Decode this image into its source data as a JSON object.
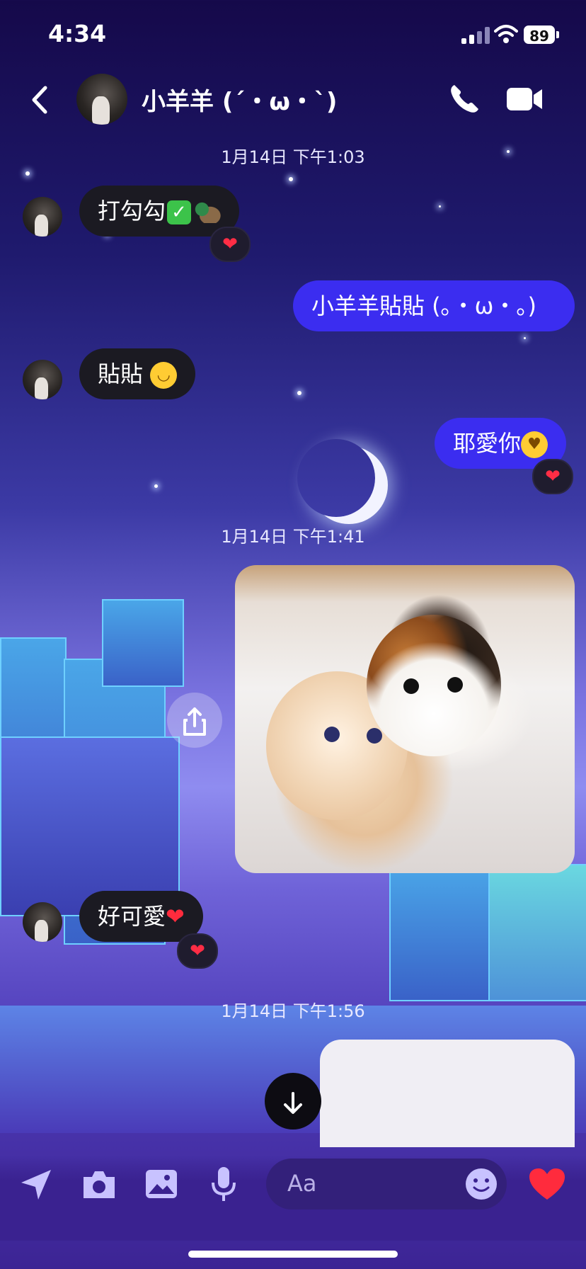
{
  "status_bar": {
    "time": "4:34",
    "battery": "89"
  },
  "header": {
    "contact_name": "小羊羊 (´・ω・`)",
    "back_icon": "chevron-left-icon",
    "call_icon": "phone-icon",
    "video_icon": "video-camera-icon"
  },
  "messages": {
    "ts1": "1月14日 下午1:03",
    "m1": {
      "text": "打勾勾",
      "reaction": "❤"
    },
    "m2": {
      "text": "小羊羊貼貼 (｡・ω・｡)"
    },
    "m3": {
      "text": "貼貼"
    },
    "m4": {
      "text": "耶愛你",
      "reaction": "❤"
    },
    "ts2": "1月14日 下午1:41",
    "m5": {
      "type": "photo"
    },
    "m6": {
      "text": "好可愛",
      "reaction": "❤"
    },
    "ts3": "1月14日 下午1:56"
  },
  "composer": {
    "placeholder": "Aa",
    "icons": [
      "location-arrow-icon",
      "camera-icon",
      "image-icon",
      "microphone-icon",
      "emoji-icon",
      "heart-icon"
    ]
  },
  "colors": {
    "sent_bubble": "#3b2df0",
    "received_bubble": "#1b1a22",
    "heart": "#ff2b3d"
  }
}
